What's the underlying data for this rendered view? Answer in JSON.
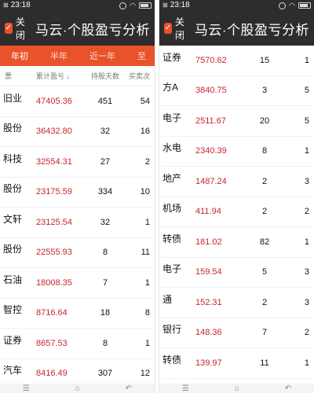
{
  "left": {
    "status": {
      "time": "23:18",
      "icon_text": "⊠"
    },
    "header": {
      "close_label": "关闭",
      "title": "马云·个股盈亏分析"
    },
    "tabs": [
      {
        "label": "年初"
      },
      {
        "label": "半年"
      },
      {
        "label": "近一年"
      },
      {
        "label": "至"
      }
    ],
    "columns": {
      "name": "票",
      "profit": "累计盈亏",
      "days": "持股天数",
      "buy": "买卖次"
    },
    "rows": [
      {
        "name": "旧业",
        "code": "",
        "profit": "47405.36",
        "days": "451",
        "buy": "54"
      },
      {
        "name": "股份",
        "code": "",
        "profit": "36432.80",
        "days": "32",
        "buy": "16"
      },
      {
        "name": "科技",
        "code": "",
        "profit": "32554.31",
        "days": "27",
        "buy": "2"
      },
      {
        "name": "股份",
        "code": "",
        "profit": "23175.59",
        "days": "334",
        "buy": "10"
      },
      {
        "name": "文轩",
        "code": "",
        "profit": "23125.54",
        "days": "32",
        "buy": "1"
      },
      {
        "name": "股份",
        "code": "",
        "profit": "22555.93",
        "days": "8",
        "buy": "11"
      },
      {
        "name": "石油",
        "code": "",
        "profit": "18008.35",
        "days": "7",
        "buy": "1"
      },
      {
        "name": "智控",
        "code": "",
        "profit": "8716.64",
        "days": "18",
        "buy": "8"
      },
      {
        "name": "证券",
        "code": "",
        "profit": "8657.53",
        "days": "8",
        "buy": "1"
      },
      {
        "name": "汽车",
        "code": "",
        "profit": "8416.49",
        "days": "307",
        "buy": "12"
      }
    ]
  },
  "right": {
    "status": {
      "time": "23:18",
      "icon_text": "⊠"
    },
    "header": {
      "close_label": "关闭",
      "title": "马云·个股盈亏分析"
    },
    "rows": [
      {
        "name": "证券",
        "code": "",
        "profit": "7570.62",
        "days": "15",
        "buy": "1"
      },
      {
        "name": "方A",
        "code": "",
        "profit": "3840.75",
        "days": "3",
        "buy": "5"
      },
      {
        "name": "电子",
        "code": "",
        "profit": "2511.67",
        "days": "20",
        "buy": "5"
      },
      {
        "name": "水电",
        "code": "",
        "profit": "2340.39",
        "days": "8",
        "buy": "1"
      },
      {
        "name": "地产",
        "code": "",
        "profit": "1487.24",
        "days": "2",
        "buy": "3"
      },
      {
        "name": "机场",
        "code": "",
        "profit": "411.94",
        "days": "2",
        "buy": "2"
      },
      {
        "name": "转债",
        "code": "",
        "profit": "181.02",
        "days": "82",
        "buy": "1"
      },
      {
        "name": "电子",
        "code": "",
        "profit": "159.54",
        "days": "5",
        "buy": "3"
      },
      {
        "name": "通",
        "code": "",
        "profit": "152.31",
        "days": "2",
        "buy": "3"
      },
      {
        "name": "银行",
        "code": "",
        "profit": "148.36",
        "days": "7",
        "buy": "2"
      },
      {
        "name": "转债",
        "code": "",
        "profit": "139.97",
        "days": "11",
        "buy": "1"
      }
    ]
  },
  "icons": {
    "app": "app-logo-icon",
    "sort": "sort-down-icon",
    "wifi": "wifi-icon",
    "battery": "battery-icon"
  },
  "colors": {
    "header_bg": "#2f2c2f",
    "tab_bg": "#e9532b",
    "profit_red": "#c9262c",
    "sort_blue": "#3b7bd6"
  }
}
